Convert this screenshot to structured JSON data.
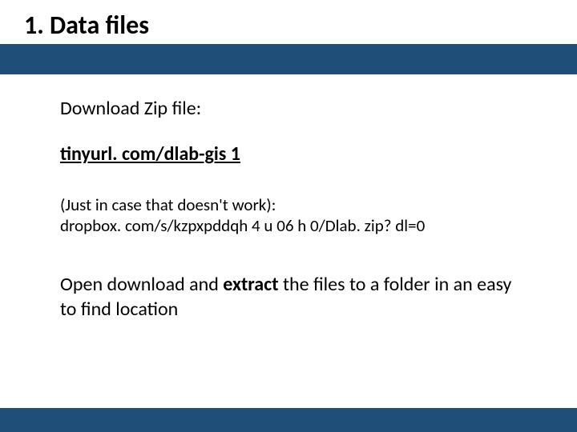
{
  "title": "1. Data files",
  "content": {
    "download_label": "Download Zip file:",
    "link_text": "tinyurl. com/dlab-gis 1",
    "fallback_label": "(Just in case that doesn't work):",
    "fallback_url": "dropbox. com/s/kzpxpddqh 4 u 06 h 0/Dlab. zip? dl=0",
    "instruction_pre": "Open download and ",
    "instruction_bold": "extract",
    "instruction_post": " the files to a folder in an easy to find location"
  }
}
